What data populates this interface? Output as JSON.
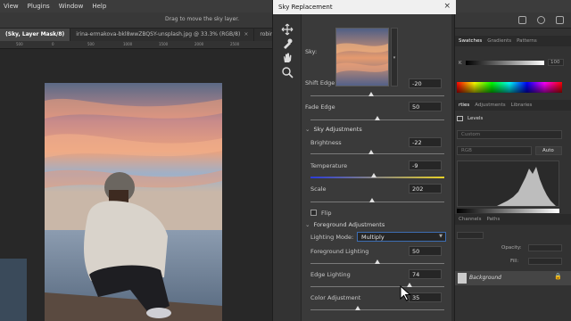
{
  "menubar": {
    "items": [
      "View",
      "Plugins",
      "Window",
      "Help"
    ]
  },
  "optbar": {
    "hint": "Drag to move the sky layer."
  },
  "tabs": [
    {
      "label": "(Sky, Layer Mask/8)",
      "active": true
    },
    {
      "label": "irina-ermakova-bkl8wwZBQSY-unsplash.jpg @ 33.3% (RGB/8)",
      "active": false
    },
    {
      "label": "robin-stief-fQo",
      "active": false
    }
  ],
  "ruler": {
    "marks": [
      "500",
      "0",
      "500",
      "1000",
      "1500",
      "2000",
      "2500"
    ]
  },
  "dialog": {
    "title": "Sky Replacement",
    "close": "×",
    "sky_label": "Sky:",
    "shift_edge": {
      "label": "Shift Edge",
      "value": "-20",
      "fraction": 0.45
    },
    "fade_edge": {
      "label": "Fade Edge",
      "value": "50",
      "fraction": 0.5
    },
    "sky_adjustments": "Sky Adjustments",
    "brightness": {
      "label": "Brightness",
      "value": "-22",
      "fraction": 0.45
    },
    "temperature": {
      "label": "Temperature",
      "value": "-9",
      "fraction": 0.47
    },
    "scale": {
      "label": "Scale",
      "value": "202",
      "fraction": 0.46
    },
    "flip_label": "Flip",
    "foreground_adjustments": "Foreground Adjustments",
    "lighting_mode_label": "Lighting Mode:",
    "lighting_mode_value": "Multiply",
    "foreground_lighting": {
      "label": "Foreground Lighting",
      "value": "50",
      "fraction": 0.5
    },
    "edge_lighting": {
      "label": "Edge Lighting",
      "value": "74",
      "fraction": 0.74
    },
    "color_adjustment": {
      "label": "Color Adjustment",
      "value": "35",
      "fraction": 0.35
    }
  },
  "panels": {
    "color_tabs": [
      "Swatches",
      "Gradients",
      "Patterns"
    ],
    "color_k_label": "K",
    "color_k_value": "100",
    "props_tabs": [
      "rties",
      "Adjustments",
      "Libraries"
    ],
    "levels_label": "Levels",
    "preset_value": "Custom",
    "channel_value": "RGB",
    "auto_label": "Auto",
    "layers_tabs": [
      "Channels",
      "Paths"
    ],
    "opacity_label": "Opacity:",
    "fill_label": "Fill:",
    "background_layer": "Background"
  },
  "colors": {
    "accent": "#3d6db3",
    "dialog_bg": "#3a3a3a",
    "panel_bg": "#323232"
  }
}
